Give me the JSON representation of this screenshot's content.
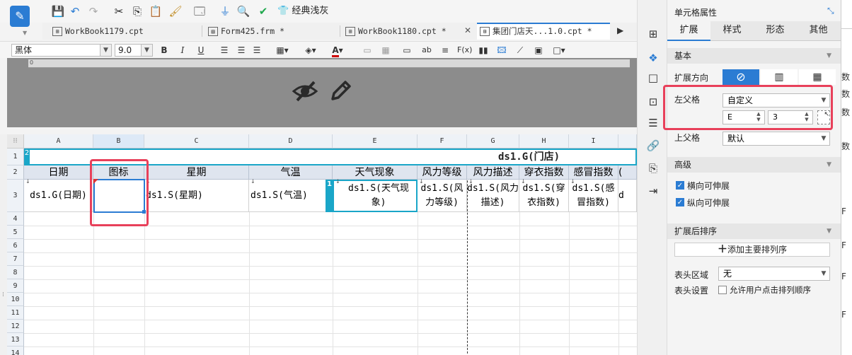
{
  "toolbar": {
    "classic_theme_label": "经典浅灰"
  },
  "tabs": [
    {
      "label": "WorkBook1179.cpt",
      "icon": "grid"
    },
    {
      "label": "Form425.frm *",
      "icon": "form"
    },
    {
      "label": "WorkBook1180.cpt *",
      "icon": "grid"
    },
    {
      "label": "集团门店天...1.0.cpt *",
      "icon": "grid",
      "active": true
    }
  ],
  "format": {
    "font": "黑体",
    "size": "9.0"
  },
  "ruler": {
    "zero": "0"
  },
  "grid": {
    "columns": [
      "A",
      "B",
      "C",
      "D",
      "E",
      "F",
      "G",
      "H",
      "I"
    ],
    "rows": [
      "1",
      "2",
      "3",
      "4",
      "5",
      "6",
      "7",
      "8",
      "9",
      "10",
      "11",
      "12",
      "13",
      "14"
    ],
    "row1_label": "2",
    "store_title": "ds1.G(门店)",
    "headers": [
      "日期",
      "图标",
      "星期",
      "气温",
      "天气现象",
      "风力等级",
      "风力描述",
      "穿衣指数",
      "感冒指数",
      "("
    ],
    "row3": [
      "ds1.G(日期)",
      "",
      "ds1.S(星期)",
      "ds1.S(气温)",
      "ds1.S(天气现象)",
      "ds1.S(风力等级)",
      "ds1.S(风力描述)",
      "ds1.S(穿衣指数)",
      "ds1.S(感冒指数)",
      "d"
    ],
    "e3_marker": "1"
  },
  "panel": {
    "title": "单元格属性",
    "tabs": [
      "扩展",
      "样式",
      "形态",
      "其他"
    ],
    "active_tab": "扩展",
    "sections": {
      "basic": "基本",
      "advanced": "高级",
      "sort": "扩展后排序"
    },
    "expand_direction_label": "扩展方向",
    "left_parent_label": "左父格",
    "left_parent_value": "自定义",
    "left_parent_col": "E",
    "left_parent_row": "3",
    "upper_parent_label": "上父格",
    "upper_parent_value": "默认",
    "horizontal_expand": "横向可伸展",
    "vertical_expand": "纵向可伸展",
    "add_sort_label": "添加主要排列序",
    "header_area_label": "表头区域",
    "header_area_value": "无",
    "header_setting_label": "表头设置",
    "allow_user_sort_label": "允许用户点击排列顺序"
  },
  "edge_texts": [
    "数",
    "数",
    "数",
    "数",
    "F",
    "F",
    "F",
    "F"
  ],
  "colors": {
    "accent": "#2b7cd3",
    "highlight": "#e8405a",
    "teal": "#1aa6c8"
  }
}
